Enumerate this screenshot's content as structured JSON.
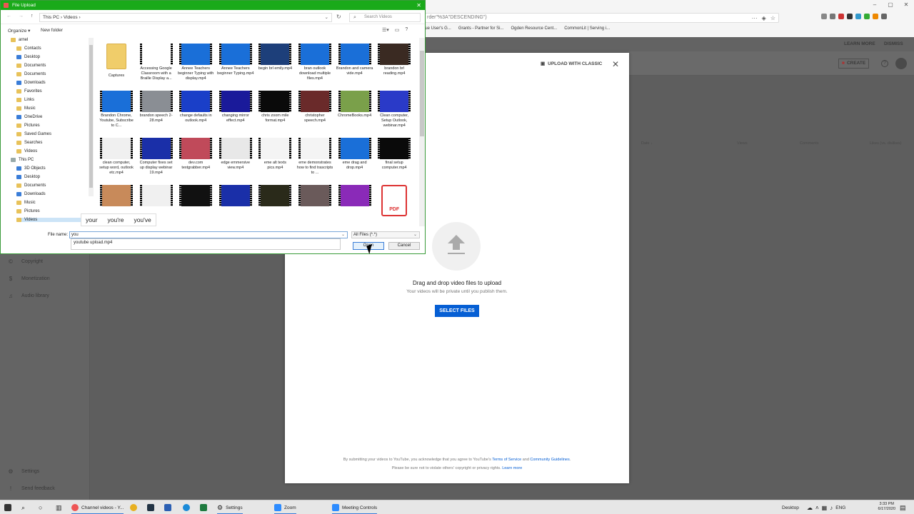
{
  "browser": {
    "url_fragment": "rder\"%3A\"DESCENDING\")",
    "bookmarks": [
      "Blue User's G...",
      "Grants - Partner for Si...",
      "Ogden Resource Cent...",
      "CommonLit | Serving i..."
    ]
  },
  "studio": {
    "banner_learn": "LEARN MORE",
    "banner_dismiss": "DISMISS",
    "create_label": "CREATE",
    "sidebar": [
      {
        "label": "Copyright",
        "icon": "copyright-icon",
        "glyph": "©"
      },
      {
        "label": "Monetization",
        "icon": "dollar-icon",
        "glyph": "$"
      },
      {
        "label": "Audio library",
        "icon": "audio-library-icon",
        "glyph": "♫"
      },
      {
        "label": "Settings",
        "icon": "gear-icon",
        "glyph": "⚙"
      },
      {
        "label": "Send feedback",
        "icon": "feedback-icon",
        "glyph": "!"
      }
    ],
    "columns": [
      "Date ↓",
      "Views",
      "Comments",
      "Likes (vs. dislikes)"
    ]
  },
  "upload": {
    "classic_label": "UPLOAD WITH CLASSIC",
    "drag_title": "Drag and drop video files to upload",
    "drag_sub": "Your videos will be private until you publish them.",
    "select_label": "SELECT FILES",
    "legal1_pre": "By submitting your videos to YouTube, you acknowledge that you agree to YouTube's ",
    "legal1_tos": "Terms of Service",
    "legal1_and": " and ",
    "legal1_cg": "Community Guidelines",
    "legal1_end": ".",
    "legal2_pre": "Please be sure not to violate others' copyright or privacy rights. ",
    "legal2_link": "Learn more"
  },
  "file_dialog": {
    "title": "File Upload",
    "path": "This PC  ›  Videos  ›",
    "search_placeholder": "Search Videos",
    "organize": "Organize ▾",
    "new_folder": "New folder",
    "tree": [
      {
        "label": "arnel",
        "type": "user"
      },
      {
        "label": "Contacts",
        "type": "folder"
      },
      {
        "label": "Desktop",
        "type": "blue"
      },
      {
        "label": "Documents",
        "type": "folder"
      },
      {
        "label": "Documents",
        "type": "folder"
      },
      {
        "label": "Downloads",
        "type": "blue"
      },
      {
        "label": "Favorites",
        "type": "folder"
      },
      {
        "label": "Links",
        "type": "folder"
      },
      {
        "label": "Music",
        "type": "folder"
      },
      {
        "label": "OneDrive",
        "type": "blue"
      },
      {
        "label": "Pictures",
        "type": "folder"
      },
      {
        "label": "Saved Games",
        "type": "folder"
      },
      {
        "label": "Searches",
        "type": "folder"
      },
      {
        "label": "Videos",
        "type": "folder"
      },
      {
        "label": "This PC",
        "type": "gray"
      },
      {
        "label": "3D Objects",
        "type": "blue"
      },
      {
        "label": "Desktop",
        "type": "blue"
      },
      {
        "label": "Documents",
        "type": "folder"
      },
      {
        "label": "Downloads",
        "type": "blue"
      },
      {
        "label": "Music",
        "type": "folder"
      },
      {
        "label": "Pictures",
        "type": "folder"
      },
      {
        "label": "Videos",
        "type": "folder",
        "selected": true
      }
    ],
    "files": [
      {
        "label": "Captures",
        "kind": "folder"
      },
      {
        "label": "Accessing Google Classroom with a Braille Display a...",
        "color": "#ffffff"
      },
      {
        "label": "Annee Teachers beginner Typing with display.mp4",
        "color": "#1a6fd8"
      },
      {
        "label": "Annee Teachers beginner Typing.mp4",
        "color": "#1a6fd8"
      },
      {
        "label": "begin brl emily.mp4",
        "color": "#1d3f7a"
      },
      {
        "label": "bran outlook download multiple files.mp4",
        "color": "#1a6fd8"
      },
      {
        "label": "Brandon and camera vide.mp4",
        "color": "#1a6fd8"
      },
      {
        "label": "brandon brl reading.mp4",
        "color": "#3a2a22"
      },
      {
        "label": "Brandon Chrome, Youtube, Subscribe to C...",
        "color": "#1a6fd8"
      },
      {
        "label": "brandon speech 2-28.mp4",
        "color": "#8a8e94"
      },
      {
        "label": "change defaults in outlook.mp4",
        "color": "#1a3fc8"
      },
      {
        "label": "changing mirror effect.mp4",
        "color": "#1a1a9a"
      },
      {
        "label": "chris zoom mile format.mp4",
        "color": "#0a0a0a"
      },
      {
        "label": "christopher speech.mp4",
        "color": "#6a2a2a"
      },
      {
        "label": "ChromeBooks.mp4",
        "color": "#7aa04a"
      },
      {
        "label": "Clean computer, Setup Outlook, webinar.mp4",
        "color": "#2a3ac8"
      },
      {
        "label": "clean computer, setup word, outlook etc.mp4",
        "color": "#f0f0f0"
      },
      {
        "label": "Computer fixes set up display webinar 19.mp4",
        "color": "#1a2fa8"
      },
      {
        "label": "dev.com textgrabber.mp4",
        "color": "#c04a5a"
      },
      {
        "label": "edge emmersive view.mp4",
        "color": "#e8e8e8"
      },
      {
        "label": "eme alt texts pics.mp4",
        "color": "#f4f4f4"
      },
      {
        "label": "eme demonstrates how to find trascripts to ...",
        "color": "#f4f4f4"
      },
      {
        "label": "eme drag and drop.mp4",
        "color": "#1a6fd8"
      },
      {
        "label": "final setup computer.mp4",
        "color": "#0a0a0a"
      },
      {
        "label": "",
        "color": "#c88a5a"
      },
      {
        "label": "",
        "color": "#f0f0f0"
      },
      {
        "label": "",
        "color": "#111111"
      },
      {
        "label": "",
        "color": "#1a2fa8"
      },
      {
        "label": "",
        "color": "#2a2a1a"
      },
      {
        "label": "",
        "color": "#6a5a5a"
      },
      {
        "label": "",
        "color": "#8a2ab8"
      },
      {
        "label": "",
        "kind": "pdf"
      }
    ],
    "suggestions": [
      "your",
      "you're",
      "you've"
    ],
    "file_name_label": "File name:",
    "file_name_value": "you",
    "autocomplete": "youtube upload.mp4",
    "filter": "All Files (*.*)",
    "open_label": "Open",
    "cancel_label": "Cancel",
    "pdf_text": "PDF"
  },
  "taskbar": {
    "items": [
      "Channel videos - Y...",
      "Settings",
      "Zoom",
      "Meeting Controls"
    ],
    "desktop": "Desktop",
    "lang": "ENG",
    "time": "3:33 PM",
    "date": "6/17/2020"
  }
}
